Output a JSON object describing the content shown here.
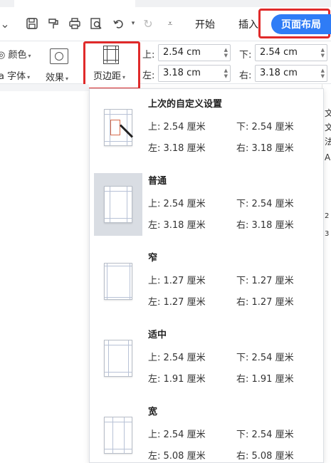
{
  "toolbar": {
    "tabs": {
      "start": "开始",
      "insert": "插入",
      "layout": "页面布局"
    }
  },
  "ribbon": {
    "color_label": "颜色",
    "font_label": "字体",
    "font_prefix": "a",
    "effect_label": "效果",
    "margin_button_label": "页边距",
    "top_label": "上:",
    "bottom_label": "下:",
    "left_label": "左:",
    "right_label": "右:",
    "top_value": "2.54 cm",
    "bottom_value": "2.54 cm",
    "left_value": "3.18 cm",
    "right_value": "3.18 cm"
  },
  "doc_right_chars": [
    "文",
    "文",
    "法",
    "A",
    "2",
    "3"
  ],
  "presets": [
    {
      "title": "上次的自定义设置",
      "top": "上: 2.54 厘米",
      "bottom": "下: 2.54 厘米",
      "left": "左: 3.18 厘米",
      "right": "右: 3.18 厘米",
      "selected": false,
      "icon": "custom-margins-icon"
    },
    {
      "title": "普通",
      "top": "上: 2.54 厘米",
      "bottom": "下: 2.54 厘米",
      "left": "左: 3.18 厘米",
      "right": "右: 3.18 厘米",
      "selected": true,
      "icon": "normal-margins-icon"
    },
    {
      "title": "窄",
      "top": "上: 1.27 厘米",
      "bottom": "下: 1.27 厘米",
      "left": "左: 1.27 厘米",
      "right": "右: 1.27 厘米",
      "selected": false,
      "icon": "narrow-margins-icon"
    },
    {
      "title": "适中",
      "top": "上: 2.54 厘米",
      "bottom": "下: 2.54 厘米",
      "left": "左: 1.91 厘米",
      "right": "右: 1.91 厘米",
      "selected": false,
      "icon": "moderate-margins-icon"
    },
    {
      "title": "宽",
      "top": "上: 2.54 厘米",
      "bottom": "下: 2.54 厘米",
      "left": "左: 5.08 厘米",
      "right": "右: 5.08 厘米",
      "selected": false,
      "icon": "wide-margins-icon"
    }
  ],
  "colors": {
    "accent": "#2f7cf6",
    "highlight_border": "#e02a2a",
    "selected_bg": "#d9dde3"
  }
}
